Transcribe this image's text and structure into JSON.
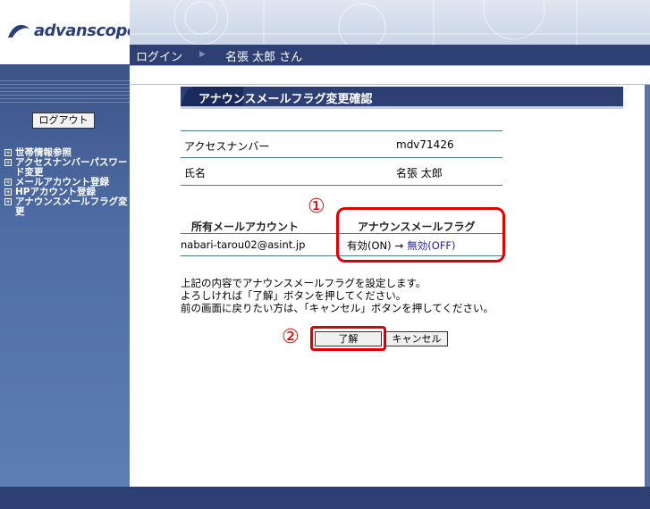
{
  "brand": {
    "name": "advanscope"
  },
  "nav": {
    "login_label": "ログイン",
    "separator": "▶",
    "user_greeting": "名張 太郎 さん"
  },
  "sidebar": {
    "logout_label": "ログアウト",
    "items": [
      {
        "label": "世帯情報参照"
      },
      {
        "label": "アクセスナンバーパスワード変更"
      },
      {
        "label": "メールアカウント登録"
      },
      {
        "label": "HPアカウント登録"
      },
      {
        "label": "アナウンスメールフラグ変更"
      }
    ],
    "item_marker": "+"
  },
  "main": {
    "title": "アナウンスメールフラグ変更確認",
    "info": [
      {
        "key": "アクセスナンバー",
        "value": "mdv71426"
      },
      {
        "key": "氏名",
        "value": "名張 太郎"
      }
    ],
    "accounts": {
      "headers": {
        "account": "所有メールアカウント",
        "flag": "アナウンスメールフラグ"
      },
      "rows": [
        {
          "email": "nabari-tarou02@asint.jp",
          "from": "有効(ON)",
          "arrow": "→",
          "to": "無効(OFF)"
        }
      ]
    },
    "instructions": [
      "上記の内容でアナウンスメールフラグを設定します。",
      "よろしければ「了解」ボタンを押してください。",
      "前の画面に戻りたい方は、「キャンセル」ボタンを押してください。"
    ],
    "ok_label": "了解",
    "cancel_label": "キャンセル"
  },
  "annotations": {
    "marker1": "①",
    "marker2": "②"
  },
  "colors": {
    "navy": "#2d3f73",
    "sidebar": "#4f6ea6",
    "highlight": "#e00000",
    "off_link": "#2222aa"
  }
}
